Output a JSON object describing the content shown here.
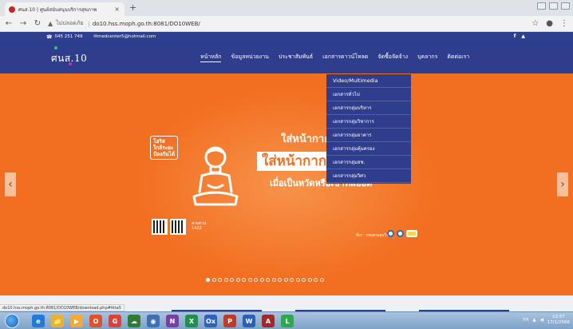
{
  "browser": {
    "tab_title": "ศนส.10 | ศูนย์สนับสนุนบริการสุขภาพ",
    "tab_close": "×",
    "new_tab": "+",
    "address": {
      "not_secure": "ไม่ปลอดภัย",
      "url": "do10.hss.moph.go.th:8081/DO10WEB/"
    }
  },
  "site": {
    "topbar": {
      "phone": "045 251 749",
      "email": "medcenter5@hotmail.com",
      "social": [
        "f",
        "▲"
      ]
    },
    "logo": "ศนส.10",
    "menu": [
      "หน้าหลัก",
      "ข้อมูลหน่วยงาน",
      "ประชาสัมพันธ์",
      "เอกสารดาวน์โหลด",
      "จัดซื้อจัดจ้าง",
      "บุคลากร",
      "ติดต่อเรา"
    ],
    "dropdown": [
      "Video/Multimedia",
      "เอกสารทั่วไป",
      "เอกสารกลุ่มบริหาร",
      "เอกสารกลุ่มวิชาการ",
      "เอกสารกลุ่มอาคาร",
      "เอกสารกลุ่มคุ้มครอง",
      "เอกสารกลุ่มสช.",
      "เอกสารกลุ่มวิศว"
    ],
    "hero": {
      "badge": [
        "โอริส",
        "ใกล้ระยะ",
        "ป้องกันได้"
      ],
      "line1": "ใส่หน้ากาก",
      "line2": "ใส่หน้ากากอนามัยทุกครั้ง",
      "line3": "เมื่อเป็นหวัดหรือเข้าที่แออัด",
      "credit": "ที่มา : กรมควบคุมโรค",
      "side_logo": [
        "สายด่วน",
        "1422"
      ]
    },
    "slider": {
      "total": 20,
      "active": 0
    }
  },
  "status_url": "do10.hss.moph.go.th:8081/DO10WEB/download.php#tkta5",
  "taskbar": {
    "apps": [
      "e",
      "📁",
      "▶",
      "O",
      "G",
      "☁",
      "◉",
      "N",
      "X",
      "Ox",
      "P",
      "W",
      "A",
      "L"
    ],
    "tray_lang": "TH",
    "time": "12:57",
    "date": "17/1/2566"
  }
}
